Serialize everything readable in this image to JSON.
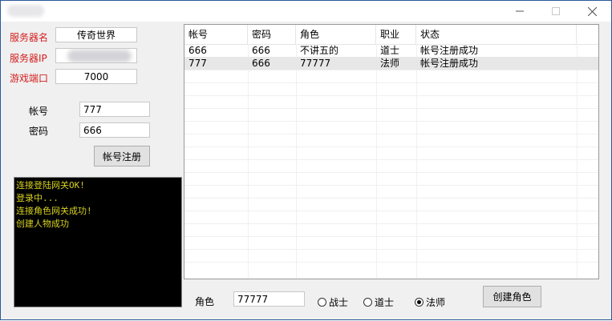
{
  "server": {
    "name_label": "服务器名",
    "name_value": "传奇世界",
    "ip_label": "服务器IP",
    "port_label": "游戏端口",
    "port_value": "7000"
  },
  "account": {
    "user_label": "帐号",
    "user_value": "777",
    "pass_label": "密码",
    "pass_value": "666",
    "register_button": "帐号注册"
  },
  "console_lines": [
    "连接登陆网关OK!",
    "登录中...",
    "连接角色网关成功!",
    "创建人物成功"
  ],
  "table": {
    "columns": [
      "帐号",
      "密码",
      "角色",
      "职业",
      "状态"
    ],
    "rows": [
      [
        "666",
        "666",
        "不讲五的",
        "道士",
        "帐号注册成功"
      ],
      [
        "777",
        "666",
        "77777",
        "法师",
        "帐号注册成功"
      ]
    ]
  },
  "role": {
    "label": "角色",
    "value": "77777",
    "options": [
      {
        "label": "战士",
        "selected": false
      },
      {
        "label": "道士",
        "selected": false
      },
      {
        "label": "法师",
        "selected": true
      }
    ],
    "create_button": "创建角色"
  },
  "colors": {
    "label_red": "#d31e1e",
    "console_text": "#d8d21f",
    "console_bg": "#000000"
  }
}
